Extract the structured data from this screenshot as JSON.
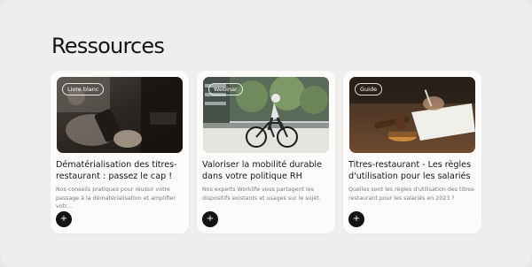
{
  "section": {
    "title": "Ressources"
  },
  "cards": [
    {
      "badge": "Livre blanc",
      "title": "Dématérialisation des titres-restaurant : passez le cap !",
      "description": "Nos conseils pratiques pour réussir votre passage à la dématérialisation et amplifier votr…",
      "action_icon": "+"
    },
    {
      "badge": "Webinar",
      "title": "Valoriser la mobilité durable dans votre politique RH",
      "description": "Nos experts Worklife vous partagent les dispositifs existants et usages sur le sujet.",
      "action_icon": "+"
    },
    {
      "badge": "Guide",
      "title": "Titres-restaurant - Les règles d'utilisation pour les salariés",
      "description": "Quelles sont les règles d'utilisation des titres-restaurant pour les salariés en 2023 ?",
      "action_icon": "+"
    }
  ]
}
